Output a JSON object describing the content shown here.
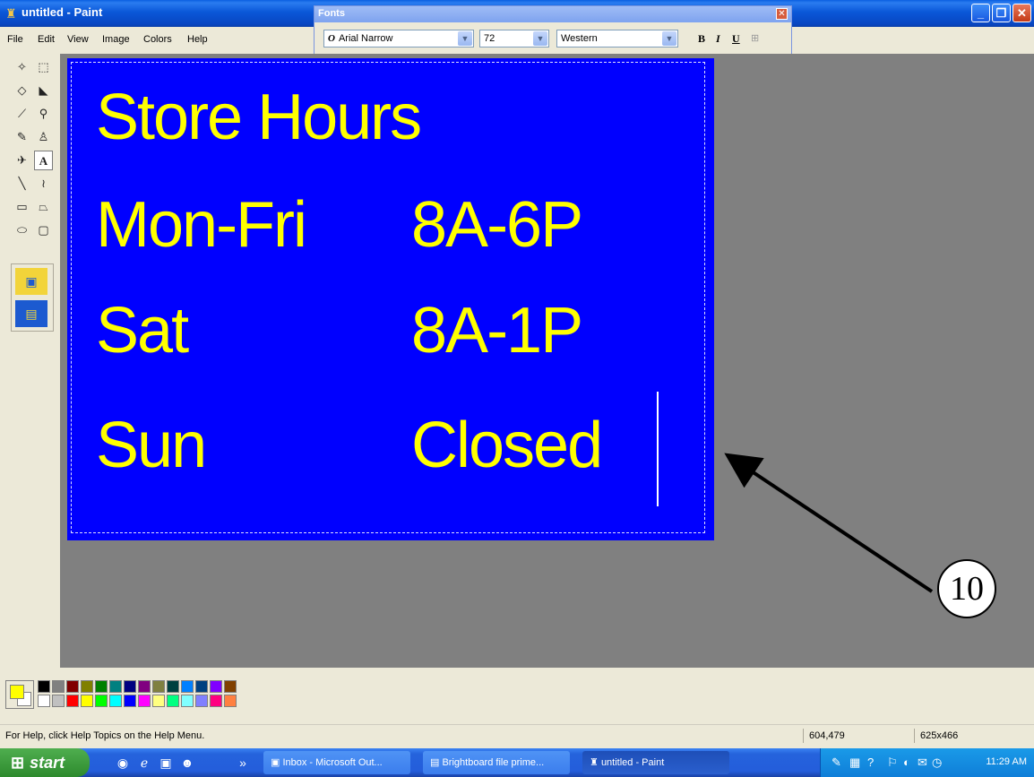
{
  "window": {
    "title": "untitled - Paint",
    "controls": {
      "minimize": "_",
      "maximize": "❐",
      "close": "✕"
    }
  },
  "menu": [
    "File",
    "Edit",
    "View",
    "Image",
    "Colors",
    "Help"
  ],
  "fonts_toolbar": {
    "title": "Fonts",
    "close": "✕",
    "font_name": "Arial Narrow",
    "font_type_icon": "O",
    "font_size": "72",
    "script": "Western",
    "bold": "B",
    "italic": "I",
    "underline": "U",
    "vertical": "⊞"
  },
  "tools": [
    {
      "icon": "free-select",
      "glyph": "✧"
    },
    {
      "icon": "rect-select",
      "glyph": "⬚"
    },
    {
      "icon": "eraser",
      "glyph": "◇"
    },
    {
      "icon": "fill",
      "glyph": "◣"
    },
    {
      "icon": "color-picker",
      "glyph": "⟋"
    },
    {
      "icon": "magnifier",
      "glyph": "⚲"
    },
    {
      "icon": "pencil",
      "glyph": "✎"
    },
    {
      "icon": "brush",
      "glyph": "♙"
    },
    {
      "icon": "airbrush",
      "glyph": "✈"
    },
    {
      "icon": "text",
      "glyph": "A",
      "selected": true
    },
    {
      "icon": "line",
      "glyph": "╲"
    },
    {
      "icon": "curve",
      "glyph": "≀"
    },
    {
      "icon": "rectangle",
      "glyph": "▭"
    },
    {
      "icon": "polygon",
      "glyph": "⏢"
    },
    {
      "icon": "ellipse",
      "glyph": "⬭"
    },
    {
      "icon": "rounded-rectangle",
      "glyph": "▢"
    }
  ],
  "text_options": [
    "▣",
    "▤"
  ],
  "canvas": {
    "background": "#0000ff",
    "text_color": "#ffff00",
    "lines": [
      {
        "left": "Store Hours",
        "right": ""
      },
      {
        "left": "Mon-Fri",
        "right": "8A-6P"
      },
      {
        "left": "Sat",
        "right": "8A-1P"
      },
      {
        "left": "Sun",
        "right": "Closed"
      }
    ]
  },
  "annotation": {
    "label": "10"
  },
  "palette": {
    "foreground": "#ffff00",
    "background": "#ffffff",
    "top_row": [
      "#000000",
      "#808080",
      "#800000",
      "#808000",
      "#008000",
      "#008080",
      "#000080",
      "#800080",
      "#808040",
      "#004040",
      "#0080ff",
      "#004080",
      "#8000ff",
      "#804000"
    ],
    "bottom_row": [
      "#ffffff",
      "#c0c0c0",
      "#ff0000",
      "#ffff00",
      "#00ff00",
      "#00ffff",
      "#0000ff",
      "#ff00ff",
      "#ffff80",
      "#00ff80",
      "#80ffff",
      "#8080ff",
      "#ff0080",
      "#ff8040"
    ]
  },
  "status": {
    "help": "For Help, click Help Topics on the Help Menu.",
    "coords": "604,479",
    "size": "625x466"
  },
  "taskbar": {
    "start": "start",
    "quick_launch": [
      "◉",
      "ℯ",
      "▣",
      "☻"
    ],
    "chevron": "»",
    "tasks": [
      {
        "label": "Inbox - Microsoft Out...",
        "icon": "▣"
      },
      {
        "label": "Brightboard file prime...",
        "icon": "▤"
      },
      {
        "label": "untitled - Paint",
        "icon": "♜",
        "active": true
      }
    ],
    "tray_icons": [
      "✎",
      "▦",
      "?",
      "⚐",
      "◐",
      "✉",
      "◷"
    ],
    "clock": "11:29 AM"
  }
}
